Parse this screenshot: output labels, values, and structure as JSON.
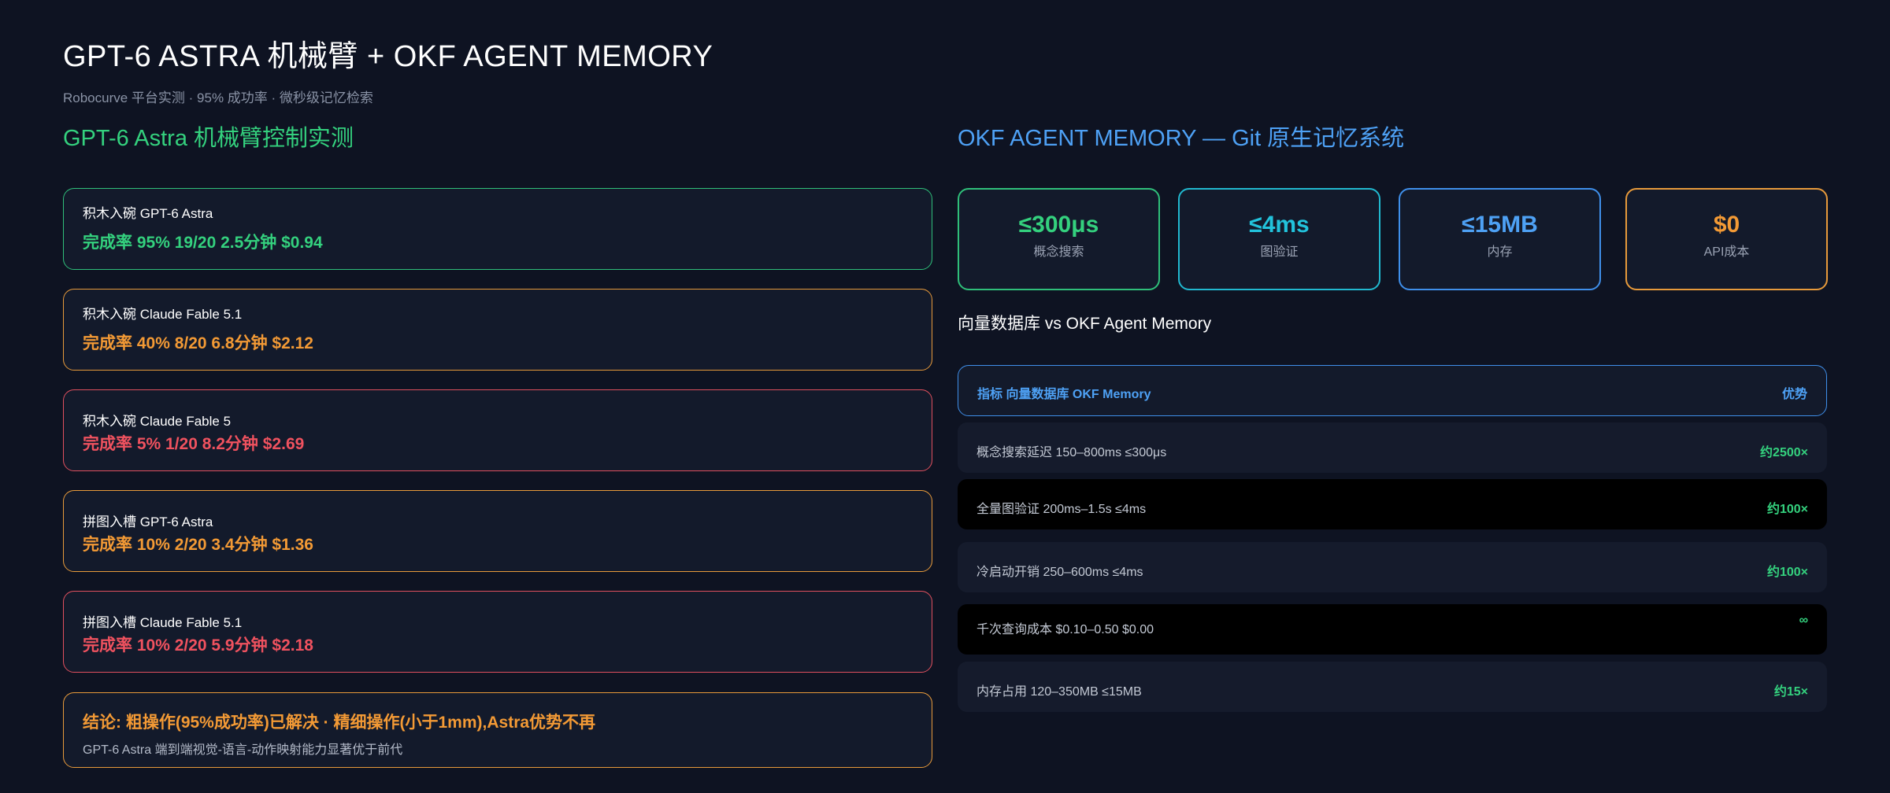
{
  "header": {
    "title": "GPT-6 ASTRA 机械臂 + OKF AGENT MEMORY",
    "subtitle": "Robocurve 平台实测 · 95% 成功率 · 微秒级记忆检索"
  },
  "left": {
    "section_title": "GPT-6 Astra 机械臂控制实测",
    "cards": [
      {
        "title": "积木入碗 GPT-6 Astra",
        "stat": "完成率 95% 19/20 2.5分钟 $0.94",
        "color": "#34d17e"
      },
      {
        "title": "积木入碗 Claude Fable 5.1",
        "stat": "完成率 40% 8/20 6.8分钟 $2.12",
        "color": "#f39a35"
      },
      {
        "title": "积木入碗 Claude Fable 5",
        "stat": "完成率 5% 1/20 8.2分钟 $2.69",
        "color": "#f0525f"
      },
      {
        "title": "拼图入槽 GPT-6 Astra",
        "stat": "完成率 10% 2/20 3.4分钟 $1.36",
        "color": "#f39a35"
      },
      {
        "title": "拼图入槽 Claude Fable 5.1",
        "stat": "完成率 10% 2/20 5.9分钟 $2.18",
        "color": "#f0525f"
      }
    ],
    "conclusion": {
      "title": "结论: 粗操作(95%成功率)已解决 · 精细操作(小于1mm),Astra优势不再",
      "subtitle": "GPT-6 Astra 端到端视觉-语言-动作映射能力显著优于前代"
    }
  },
  "right": {
    "section_title": "OKF AGENT MEMORY — Git 原生记忆系统",
    "metrics": [
      {
        "value": "≤300μs",
        "label": "概念搜索",
        "color": "#34d17e"
      },
      {
        "value": "≤4ms",
        "label": "图验证",
        "color": "#22c3dc"
      },
      {
        "value": "≤15MB",
        "label": "内存",
        "color": "#4ea1f5"
      },
      {
        "value": "$0",
        "label": "API成本",
        "color": "#f39a35"
      }
    ],
    "compare_title": "向量数据库 vs OKF Agent Memory",
    "table_header": {
      "left": "指标 向量数据库 OKF Memory",
      "right": "优势"
    },
    "rows": [
      {
        "label": "概念搜索延迟 150–800ms ≤300μs",
        "advantage": "约2500×"
      },
      {
        "label": "全量图验证 200ms–1.5s ≤4ms",
        "advantage": "约100×"
      },
      {
        "label": "冷启动开销 250–600ms ≤4ms",
        "advantage": "约100×"
      },
      {
        "label": "千次查询成本 $0.10–0.50 $0.00",
        "advantage": "∞"
      },
      {
        "label": "内存占用 120–350MB ≤15MB",
        "advantage": "约15×"
      }
    ]
  }
}
